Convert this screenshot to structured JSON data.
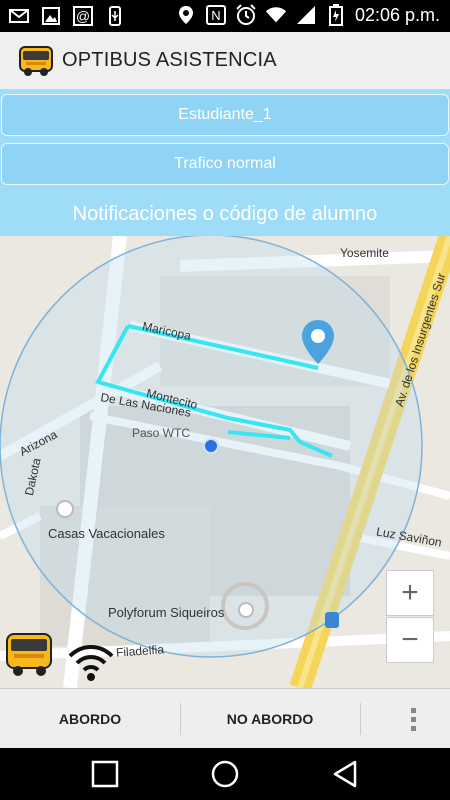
{
  "status": {
    "time": "02:06 p.m.",
    "icons_left": [
      "mail-icon",
      "image-icon",
      "at-icon",
      "usb-icon"
    ],
    "icons_right": [
      "location-icon",
      "nfc-icon",
      "alarm-icon",
      "wifi-icon",
      "signal-icon",
      "battery-icon"
    ]
  },
  "app": {
    "title": "OPTIBUS ASISTENCIA",
    "icon": "bus-icon"
  },
  "panel": {
    "student": "Estudiante_1",
    "traffic": "Trafico normal",
    "notifications": "Notificaciones o código de alumno",
    "background": "#9fdcf7"
  },
  "map": {
    "labels": {
      "yosemite": "Yosemite",
      "insurgentes": "Av. de los Insurgentes Sur",
      "maricopa": "Maricopa",
      "montecito": "Montecito",
      "naciones": "De Las Naciones",
      "paso_wtc": "Paso WTC",
      "arizona": "Arizona",
      "dakota": "Dakota",
      "casas": "Casas Vacacionales",
      "luz_savinon": "Luz Saviñon",
      "polyforum": "Polyforum Siqueiros",
      "filadelfia": "Filadelfia"
    },
    "route_color": "#36e6f2",
    "marker_color": "#4aa3df",
    "zoom_in": "+",
    "zoom_out": "−"
  },
  "bottom": {
    "abordo": "ABORDO",
    "no_abordo": "NO ABORDO"
  },
  "nav": {
    "buttons": [
      "recents-icon",
      "home-icon",
      "back-icon"
    ]
  }
}
